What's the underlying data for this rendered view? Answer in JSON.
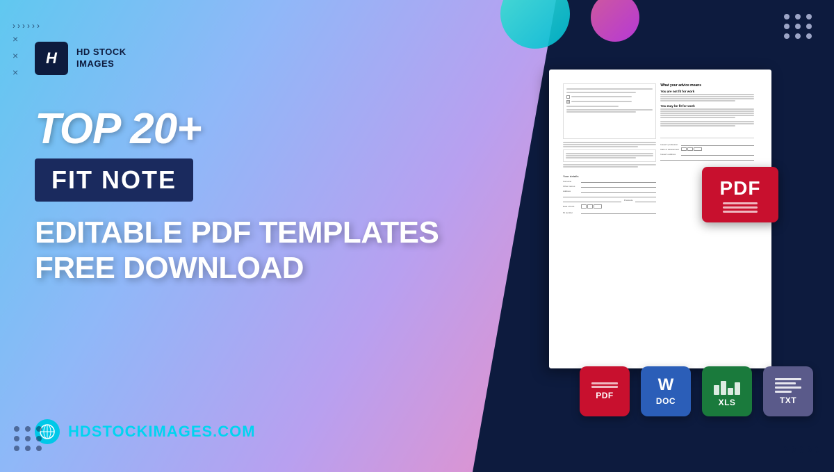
{
  "background": {
    "gradient_from": "#60c8f0",
    "gradient_to": "#f8b0d0"
  },
  "logo": {
    "letter": "H",
    "line1": "HD STOCK",
    "line2": "IMAGES"
  },
  "heading": {
    "top_line": "TOP 20+",
    "badge_text": "FIT NOTE",
    "subtitle_line1": "EDITABLE PDF TEMPLATES",
    "subtitle_line2": "FREE DOWNLOAD"
  },
  "website": {
    "url": "HDSTOCKIMAGES.COM"
  },
  "formats": [
    {
      "type": "pdf",
      "label": "PDF"
    },
    {
      "type": "doc",
      "label": "DOC"
    },
    {
      "type": "xls",
      "label": "XLS"
    },
    {
      "type": "txt",
      "label": "TXT"
    }
  ],
  "document": {
    "title": "Fit Note",
    "pdf_label": "PDF"
  },
  "decorations": {
    "x_marks": "×",
    "arrows": "›",
    "dots_count": 9
  }
}
